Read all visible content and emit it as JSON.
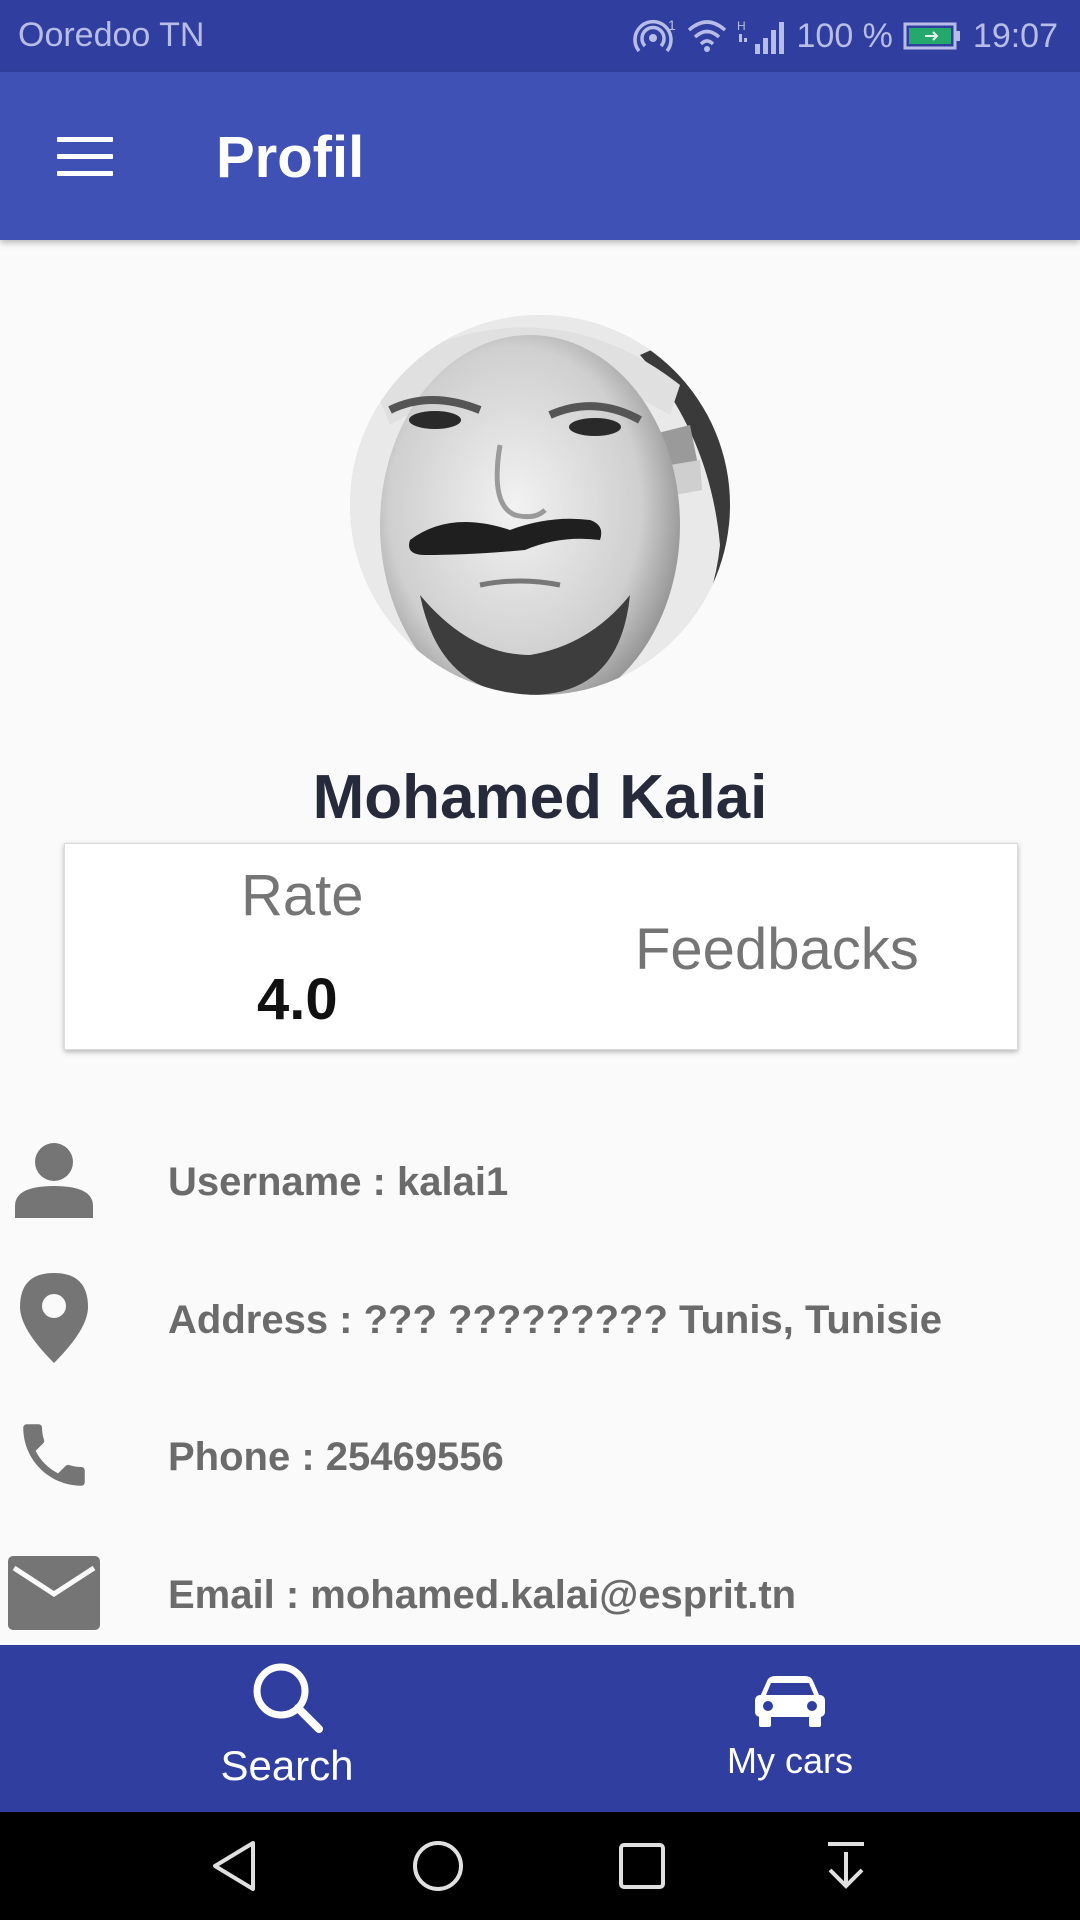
{
  "status_bar": {
    "carrier": "Ooredoo TN",
    "battery_percent": "100 %",
    "time": "19:07",
    "icons": [
      "hotspot-icon",
      "wifi-icon",
      "signal-icon",
      "battery-icon"
    ]
  },
  "app_bar": {
    "title": "Profil",
    "menu_icon": "menu-icon"
  },
  "profile": {
    "name": "Mohamed Kalai",
    "avatar": "profile-photo"
  },
  "stats": {
    "rate_label": "Rate",
    "rate_value": "4.0",
    "feedbacks_label": "Feedbacks"
  },
  "info": {
    "username": "Username : kalai1",
    "address": "Address : ??? ????????? Tunis, Tunisie",
    "phone": "Phone : 25469556",
    "email": "Email : mohamed.kalai@esprit.tn"
  },
  "bottom_nav": {
    "search_label": "Search",
    "cars_label": "My cars"
  },
  "colors": {
    "primary": "#3f51b5",
    "primary_dark": "#303f9f",
    "icon_gray": "#757575",
    "text_gray": "#6b6b6b"
  }
}
